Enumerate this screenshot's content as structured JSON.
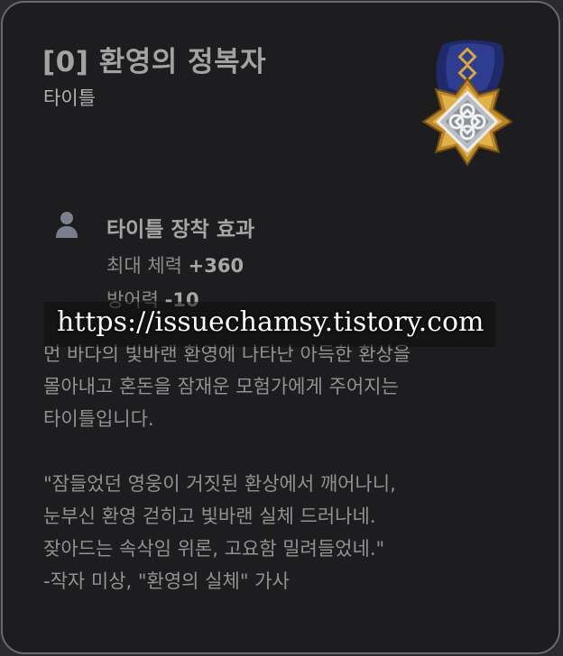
{
  "item": {
    "name": "[0] 환영의 정복자",
    "category": "타이틀"
  },
  "effect": {
    "heading": "타이틀 장착 효과",
    "stats": [
      {
        "label": "최대 체력",
        "value": "+360"
      },
      {
        "label": "방어력",
        "value": "-10"
      }
    ]
  },
  "watermark": "https://issuechamsy.tistory.com",
  "description": {
    "lines": [
      "먼 바다의 빛바랜 환영에 나타난 아득한 환상을",
      "몰아내고 혼돈을 잠재운 모험가에게 주어지는",
      "타이틀입니다."
    ],
    "quote_lines": [
      "\"잠들었던 영웅이 거짓된 환상에서 깨어나니,",
      " 눈부신 환영 걷히고 빛바랜 실체 드러나네.",
      " 잦아드는 속삭임 위론, 고요함 밀려들었네.\"",
      "-작자 미상, \"환영의 실체\" 가사"
    ]
  },
  "colors": {
    "background": "#1d1d1f",
    "border": "#6a6a6e",
    "title": "#a3a3a3",
    "text": "#929292",
    "medal_gold": "#d7a63a",
    "medal_ribbon": "#1f2a6b"
  },
  "icons": {
    "medal": "title-medal-icon",
    "person": "person-icon"
  }
}
